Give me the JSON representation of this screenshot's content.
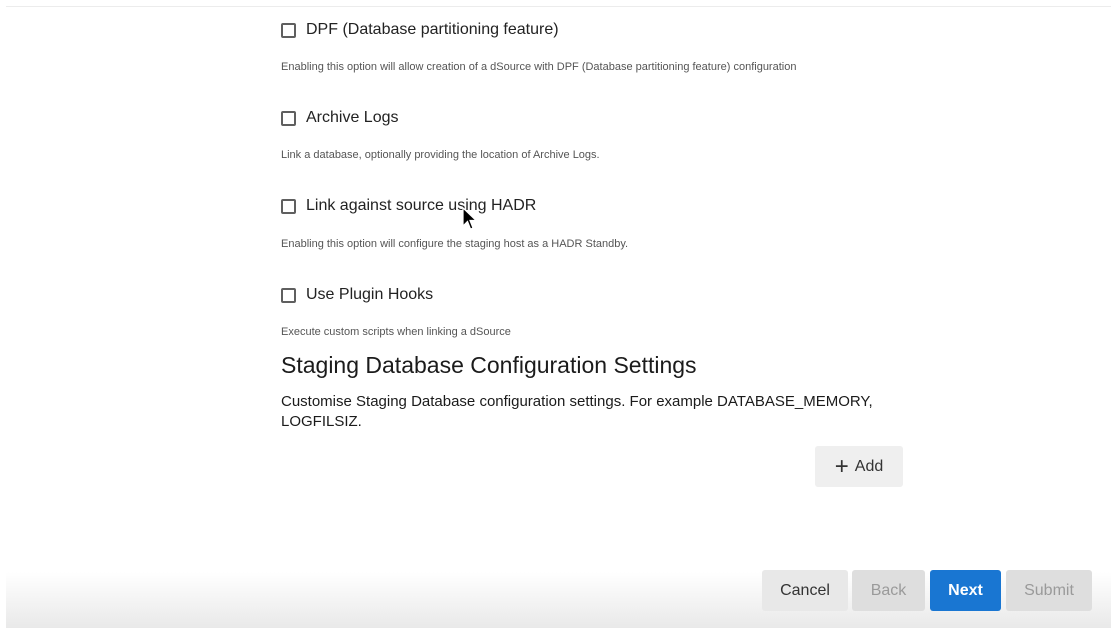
{
  "options": [
    {
      "label": "DPF (Database partitioning feature)",
      "description": "Enabling this option will allow creation of a dSource with DPF (Database partitioning feature) configuration",
      "checked": false
    },
    {
      "label": "Archive Logs",
      "description": "Link a database, optionally providing the location of Archive Logs.",
      "checked": false
    },
    {
      "label": "Link against source using HADR",
      "description": "Enabling this option will configure the staging host as a HADR Standby.",
      "checked": false
    },
    {
      "label": "Use Plugin Hooks",
      "description": "Execute custom scripts when linking a dSource",
      "checked": false
    }
  ],
  "staging": {
    "title": "Staging Database Configuration Settings",
    "description": "Customise Staging Database configuration settings. For example DATABASE_MEMORY, LOGFILSIZ.",
    "add_label": "Add",
    "add_icon": "plus-icon"
  },
  "footer": {
    "cancel_label": "Cancel",
    "back_label": "Back",
    "next_label": "Next",
    "submit_label": "Submit"
  },
  "colors": {
    "primary": "#1976d2",
    "disabled_text": "#9a9a9a"
  }
}
